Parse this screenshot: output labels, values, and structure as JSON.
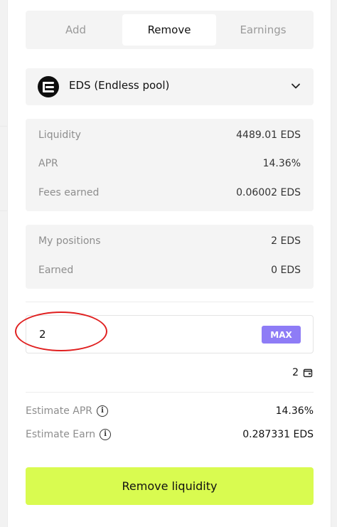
{
  "tabs": [
    {
      "label": "Add",
      "active": false
    },
    {
      "label": "Remove",
      "active": true
    },
    {
      "label": "Earnings",
      "active": false
    }
  ],
  "pool_selector": {
    "token_name": "EDS (Endless pool)",
    "icon": "eds-token-icon",
    "dropdown_icon": "chevron-down-icon"
  },
  "pool_stats": {
    "liquidity": {
      "label": "Liquidity",
      "value": "4489.01 EDS"
    },
    "apr": {
      "label": "APR",
      "value": "14.36%"
    },
    "fees": {
      "label": "Fees earned",
      "value": "0.06002 EDS"
    }
  },
  "my_position": {
    "positions": {
      "label": "My positions",
      "value": "2 EDS"
    },
    "earned": {
      "label": "Earned",
      "value": "0 EDS"
    }
  },
  "amount_input": {
    "value": "2",
    "max_label": "MAX"
  },
  "balance": {
    "value": "2",
    "icon": "wallet-icon"
  },
  "estimates": {
    "apr": {
      "label": "Estimate APR",
      "value": "14.36%"
    },
    "earn": {
      "label": "Estimate Earn",
      "value": "0.287331 EDS"
    }
  },
  "action": {
    "label": "Remove liquidity"
  },
  "colors": {
    "accent_button": "#d9fb50",
    "max_button": "#8e7cf6",
    "annotation": "#e02020",
    "card_bg": "#f4f4f4"
  }
}
